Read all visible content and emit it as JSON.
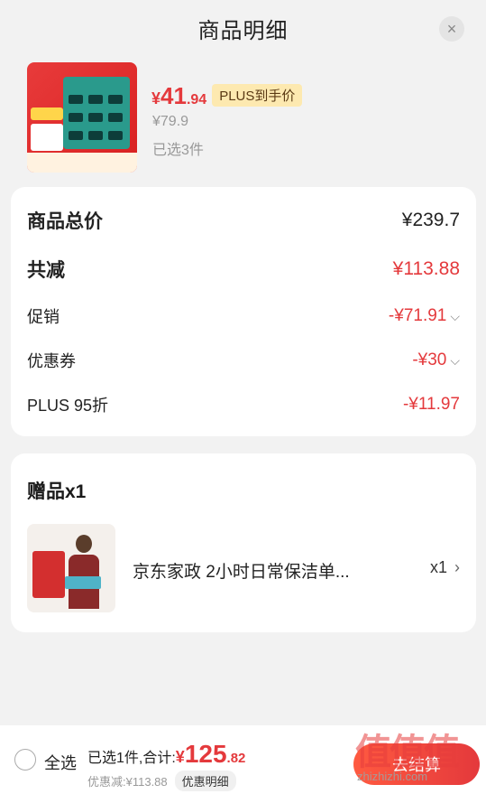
{
  "header": {
    "title": "商品明细",
    "close_icon": "×"
  },
  "product": {
    "price_symbol": "¥",
    "price_integer": "41",
    "price_decimal": ".94",
    "plus_badge": "PLUS到手价",
    "original_price": "¥79.9",
    "selected_count": "已选3件"
  },
  "summary": {
    "rows": [
      {
        "label": "商品总价",
        "value": "¥239.7"
      },
      {
        "label": "共减",
        "value": "¥113.88"
      },
      {
        "label": "促销",
        "value": "-¥71.91"
      },
      {
        "label": "优惠券",
        "value": "-¥30"
      },
      {
        "label": "PLUS 95折",
        "value": "-¥11.97"
      }
    ]
  },
  "gift": {
    "title": "赠品x1",
    "item_name": "京东家政 2小时日常保洁单...",
    "quantity": "x1"
  },
  "bottom_bar": {
    "select_all": "全选",
    "total_label": "已选1件,合计:",
    "total_symbol": "¥",
    "total_integer": "125",
    "total_decimal": ".82",
    "discount_text": "优惠减:¥113.88",
    "detail_button": "优惠明细",
    "checkout_button": "去结算"
  },
  "watermark": {
    "big": "值值值",
    "small": "zhizhizhi.com"
  },
  "colors": {
    "accent": "#e4393c",
    "plus_badge_bg": "#fde9b0",
    "background": "#f2f2f2"
  }
}
